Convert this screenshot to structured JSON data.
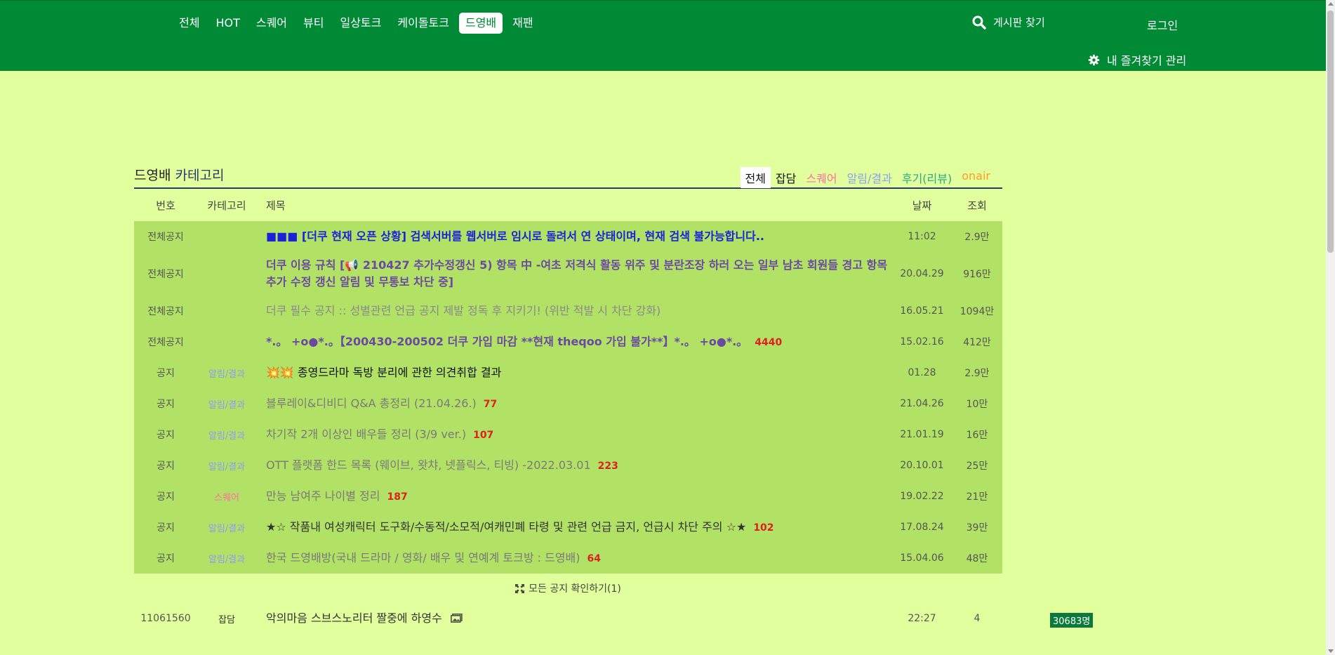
{
  "nav": {
    "items": [
      "전체",
      "HOT",
      "스퀘어",
      "뷰티",
      "일상토크",
      "케이돌토크",
      "드영배",
      "재팬"
    ],
    "active_index": 6
  },
  "search": {
    "label": "게시판 찾기"
  },
  "login": {
    "label": "로그인"
  },
  "favorites": {
    "label": "내 즐겨찾기 관리"
  },
  "board": {
    "title_main": "드영배",
    "title_sub": "카테고리",
    "categories": [
      {
        "label": "전체",
        "color": "#111111"
      },
      {
        "label": "잡담",
        "color": "#111111"
      },
      {
        "label": "스퀘어",
        "color": "#ff6fa5"
      },
      {
        "label": "알림/결과",
        "color": "#8a9ff0"
      },
      {
        "label": "후기(리뷰)",
        "color": "#2aa88a"
      },
      {
        "label": "onair",
        "color": "#ff9a2e"
      }
    ],
    "active_category": 0,
    "columns": {
      "num": "번호",
      "cat": "카테고리",
      "title": "제목",
      "date": "날짜",
      "views": "조회"
    },
    "notices": [
      {
        "num": "전체공지",
        "cat": "",
        "cat_color": "",
        "title": "■■■ [더쿠 현재 오픈 상황] 검색서버를 웹서버로 임시로 돌려서 연 상태이며, 현재 검색 불가능합니다..",
        "title_color": "#1a23d8",
        "bold": true,
        "comments": "",
        "date": "11:02",
        "views": "2.9만"
      },
      {
        "num": "전체공지",
        "cat": "",
        "cat_color": "",
        "title": "더쿠 이용 규칙 [📢 210427 추가수정갱신 5) 항목 中 -여초 저격식 활동 위주 및 분란조장 하러 오는 일부 남초 회원들 경고 항목 추가 수정 갱신 알림 및 무통보 차단 중]",
        "title_color": "#6a4aa0",
        "bold": true,
        "comments": "",
        "date": "20.04.29",
        "views": "916만",
        "tall": true
      },
      {
        "num": "전체공지",
        "cat": "",
        "cat_color": "",
        "title": "더쿠 필수 공지 :: 성별관련 언급 공지 제발 정독 후 지키기! (위반 적발 시 차단 강화)",
        "title_color": "#8a8a8a",
        "bold": false,
        "comments": "",
        "date": "16.05.21",
        "views": "1094만"
      },
      {
        "num": "전체공지",
        "cat": "",
        "cat_color": "",
        "title": "*.。 +o●*.。【200430-200502 더쿠 가입 마감 **현재 theqoo 가입 불가**】*.。 +o●*.。",
        "title_color": "#6a4aa0",
        "bold": true,
        "comments": "4440",
        "date": "15.02.16",
        "views": "412만"
      },
      {
        "num": "공지",
        "cat": "알림/결과",
        "cat_color": "#8a9ff0",
        "title": "💥💥 종영드라마 독방 분리에 관한 의견취합 결과",
        "title_color": "#111111",
        "bold": false,
        "comments": "",
        "date": "01.28",
        "views": "2.9만"
      },
      {
        "num": "공지",
        "cat": "알림/결과",
        "cat_color": "#8a9ff0",
        "title": "블루레이&디비디 Q&A 총정리 (21.04.26.)",
        "title_color": "#7a7a7a",
        "bold": false,
        "comments": "77",
        "date": "21.04.26",
        "views": "10만"
      },
      {
        "num": "공지",
        "cat": "알림/결과",
        "cat_color": "#8a9ff0",
        "title": "차기작 2개 이상인 배우들 정리 (3/9 ver.)",
        "title_color": "#7a7a7a",
        "bold": false,
        "comments": "107",
        "date": "21.01.19",
        "views": "16만"
      },
      {
        "num": "공지",
        "cat": "알림/결과",
        "cat_color": "#8a9ff0",
        "title": "OTT 플랫폼 한드 목록 (웨이브, 왓챠, 넷플릭스, 티빙) -2022.03.01",
        "title_color": "#7a7a7a",
        "bold": false,
        "comments": "223",
        "date": "20.10.01",
        "views": "25만"
      },
      {
        "num": "공지",
        "cat": "스퀘어",
        "cat_color": "#ff6fa5",
        "title": "만능 남여주 나이별 정리",
        "title_color": "#7a7a7a",
        "bold": false,
        "comments": "187",
        "date": "19.02.22",
        "views": "21만"
      },
      {
        "num": "공지",
        "cat": "알림/결과",
        "cat_color": "#8a9ff0",
        "title": "★☆ 작품내 여성캐릭터 도구화/수동적/소모적/여캐민폐 타령 및 관련 언급 금지, 언급시 차단 주의 ☆★",
        "title_color": "#333333",
        "bold": false,
        "comments": "102",
        "date": "17.08.24",
        "views": "39만"
      },
      {
        "num": "공지",
        "cat": "알림/결과",
        "cat_color": "#8a9ff0",
        "title": "한국 드영배방(국내 드라마 / 영화/ 배우 및 연예계 토크방 : 드영배)",
        "title_color": "#7a7a7a",
        "bold": false,
        "comments": "64",
        "date": "15.04.06",
        "views": "48만"
      }
    ],
    "more_label": "모든 공지 확인하기(1)",
    "posts": [
      {
        "num": "11061560",
        "cat": "잡담",
        "title": "악의마음 스브스노리터 짤중에 하영수",
        "date": "22:27",
        "views": "4"
      }
    ]
  },
  "online_badge": "30683명"
}
